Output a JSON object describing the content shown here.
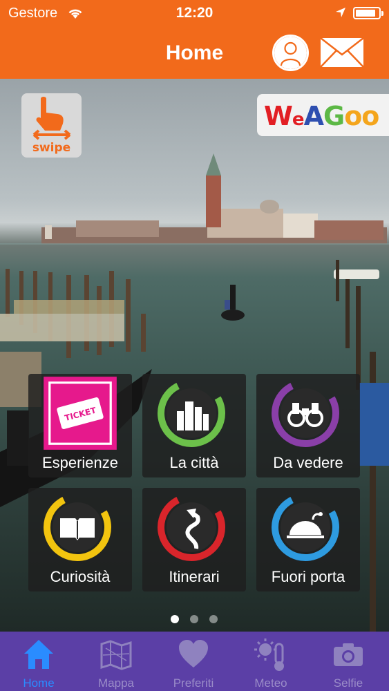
{
  "status_bar": {
    "carrier": "Gestore",
    "time": "12:20",
    "wifi_icon": "wifi-icon",
    "location_icon": "location-arrow-icon",
    "battery_icon": "battery-icon"
  },
  "nav_bar": {
    "title": "Home",
    "profile_icon": "user-profile-icon",
    "mail_icon": "mail-envelope-icon"
  },
  "hero": {
    "swipe_badge_text": "swipe",
    "brand_logo_text": "WeAGoo"
  },
  "tiles": [
    {
      "label": "Esperienze",
      "icon": "ticket-icon",
      "color": "#e6198c"
    },
    {
      "label": "La città",
      "icon": "city-buildings-icon",
      "color": "#6cc04a"
    },
    {
      "label": "Da vedere",
      "icon": "binoculars-icon",
      "color": "#8a3fa8"
    },
    {
      "label": "Curiosità",
      "icon": "open-book-icon",
      "color": "#f2c40f"
    },
    {
      "label": "Itinerari",
      "icon": "winding-road-icon",
      "color": "#d9252b"
    },
    {
      "label": "Fuori porta",
      "icon": "dish-cloche-icon",
      "color": "#2e9be0"
    }
  ],
  "pager": {
    "pages": 3,
    "current": 1
  },
  "tab_bar": {
    "items": [
      {
        "label": "Home",
        "icon": "home-icon",
        "active": true
      },
      {
        "label": "Mappa",
        "icon": "map-icon",
        "active": false
      },
      {
        "label": "Preferiti",
        "icon": "heart-icon",
        "active": false
      },
      {
        "label": "Meteo",
        "icon": "weather-thermometer-icon",
        "active": false
      },
      {
        "label": "Selfie",
        "icon": "camera-icon",
        "active": false
      }
    ]
  },
  "colors": {
    "header_orange": "#f26a1b",
    "tabbar_purple": "#5b3fa6",
    "tab_active_blue": "#2a8cff",
    "tab_inactive": "#9a8cc8"
  }
}
